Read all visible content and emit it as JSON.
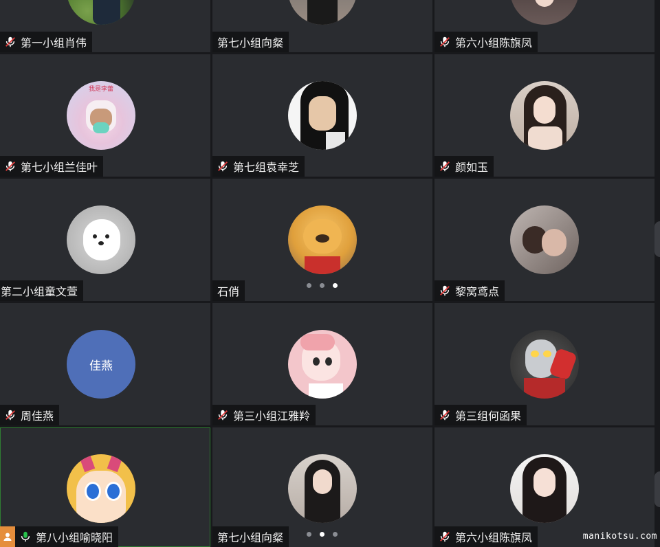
{
  "participants": [
    {
      "name": "第一小组肖伟",
      "muted": true,
      "avatar": "photo-green-outdoor"
    },
    {
      "name": "第七小组向粲",
      "muted": false,
      "avatar": "photo-woman-dark-hair"
    },
    {
      "name": "第六小组陈旗凤",
      "muted": true,
      "avatar": "photo-woman-long-hair"
    },
    {
      "name": "第七小组兰佳叶",
      "muted": true,
      "avatar": "cartoon-pink-character",
      "avatar_caption": "我是李蕾"
    },
    {
      "name": "第七组袁幸芝",
      "muted": true,
      "avatar": "cartoon-black-hair-face"
    },
    {
      "name": "颜如玉",
      "muted": true,
      "avatar": "photo-woman-hands-chin"
    },
    {
      "name": "第二小组童文萱",
      "muted": false,
      "avatar": "photo-white-puppy"
    },
    {
      "name": "石俏",
      "muted": false,
      "avatar": "cartoon-winnie-bear"
    },
    {
      "name": "黎窝鸢点",
      "muted": true,
      "avatar": "photo-heart-hands"
    },
    {
      "name": "周佳燕",
      "muted": true,
      "avatar_text": "佳燕",
      "avatar_color": "#4f6fb8"
    },
    {
      "name": "第三小组江雅羚",
      "muted": true,
      "avatar": "cartoon-pink-girl"
    },
    {
      "name": "第三组何函果",
      "muted": true,
      "avatar": "ultraman-figure"
    },
    {
      "name": "第八小组喻晓阳",
      "muted": false,
      "speaking": true,
      "is_me": true,
      "avatar": "cartoon-star-butterfly"
    },
    {
      "name": "第七小组向粲",
      "muted": false,
      "avatar": "photo-woman-black-dress"
    },
    {
      "name": "第六小组陈旗凤",
      "muted": true,
      "avatar": "photo-woman-smile"
    }
  ],
  "pagers": [
    {
      "dots": 3,
      "active": 2
    },
    {
      "dots": 3,
      "active": 1
    }
  ],
  "watermark": "manikotsu.com",
  "colors": {
    "tile": "#2a2c30",
    "namebar": "#141517",
    "speaking_mic": "#27c24c",
    "me_badge": "#e58e3c",
    "active_border": "#2f7d32"
  }
}
